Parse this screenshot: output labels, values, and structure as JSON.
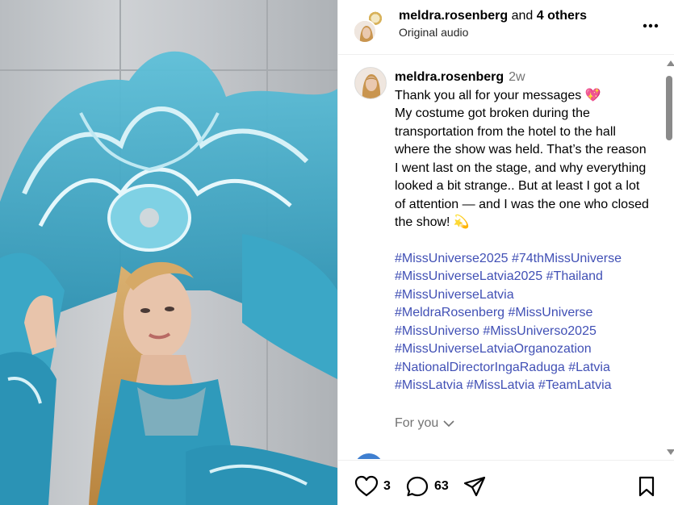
{
  "header": {
    "username": "meldra.rosenberg",
    "collab_suffix": " and ",
    "others": "4 others",
    "audio": "Original audio",
    "more_icon": "more-horizontal-icon"
  },
  "caption": {
    "username": "meldra.rosenberg",
    "time": "2w",
    "text": "Thank you all for your messages 💖\nMy costume got broken during the transportation from the hotel to the hall where the show was held. That’s the reason I went last on the stage, and why everything looked a bit strange.. But at least I got a lot of attention — and I was the one who closed the show!  💫",
    "hashtags": "#MissUniverse2025 #74thMissUniverse\n#MissUniverseLatvia2025 #Thailand\n#MissUniverseLatvia\n#MeldraRosenberg #MissUniverse\n#MissUniverso #MissUniverso2025\n#MissUniverseLatviaOrganozation\n#NationalDirectorIngaRaduga #Latvia\n#MissLatvia #MissLatvia #TeamLatvia",
    "for_you": "For you"
  },
  "actions": {
    "likes": "3",
    "comments": "63"
  },
  "colors": {
    "hashtag": "#4150b5",
    "muted": "#737373"
  }
}
